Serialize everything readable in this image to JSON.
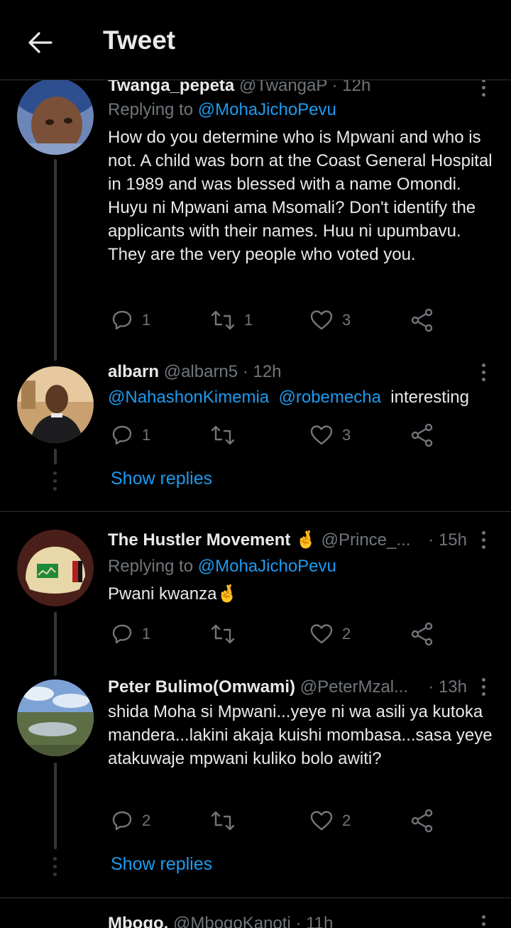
{
  "header": {
    "title": "Tweet",
    "back_icon": "arrow-left-icon"
  },
  "tweets": [
    {
      "name": "Twanga_pepeta",
      "handle": "@TwangaP",
      "time": "· 12h",
      "replying_prefix": "Replying to",
      "replying_to": "@MohaJichoPevu",
      "text": "How do you determine who is Mpwani and who is not. A child was born at the Coast General Hospital in 1989 and was blessed with a name Omondi. Huyu ni Mpwani ama Msomali? Don't identify the applicants with their names. Huu ni upumbavu. They are the very people who voted you.",
      "replies": "1",
      "retweets": "1",
      "likes": "3"
    },
    {
      "name": "albarn",
      "handle": "@albarn5",
      "time": "· 12h",
      "mention1": "@NahashonKimemia",
      "mention2": "@robemecha",
      "text": "interesting",
      "replies": "1",
      "retweets": "",
      "likes": "3",
      "show_replies": "Show replies"
    },
    {
      "name": "The Hustler Movement",
      "emoji": "🤞",
      "handle": "@Prince_...",
      "time": "· 15h",
      "replying_prefix": "Replying to",
      "replying_to": "@MohaJichoPevu",
      "text": "Pwani kwanza",
      "text_emoji": "🤞",
      "replies": "1",
      "retweets": "",
      "likes": "2"
    },
    {
      "name": "Peter Bulimo(Omwami)",
      "handle": "@PeterMzal...",
      "time": "· 13h",
      "text": "shida Moha si Mpwani...yeye ni wa asili ya kutoka mandera...lakini akaja kuishi mombasa...sasa yeye atakuwaje mpwani kuliko bolo awiti?",
      "replies": "2",
      "retweets": "",
      "likes": "2",
      "show_replies": "Show replies"
    },
    {
      "name": "Mbogo.",
      "handle": "@MbogoKanoti",
      "time": "· 11h"
    }
  ],
  "colors": {
    "accent": "#1d9bf0",
    "muted": "#71767b",
    "text": "#e7e9ea",
    "background": "#000000"
  },
  "icons": {
    "reply": "comment-icon",
    "retweet": "retweet-icon",
    "like": "heart-icon",
    "share": "share-icon",
    "more": "more-vertical-icon"
  }
}
